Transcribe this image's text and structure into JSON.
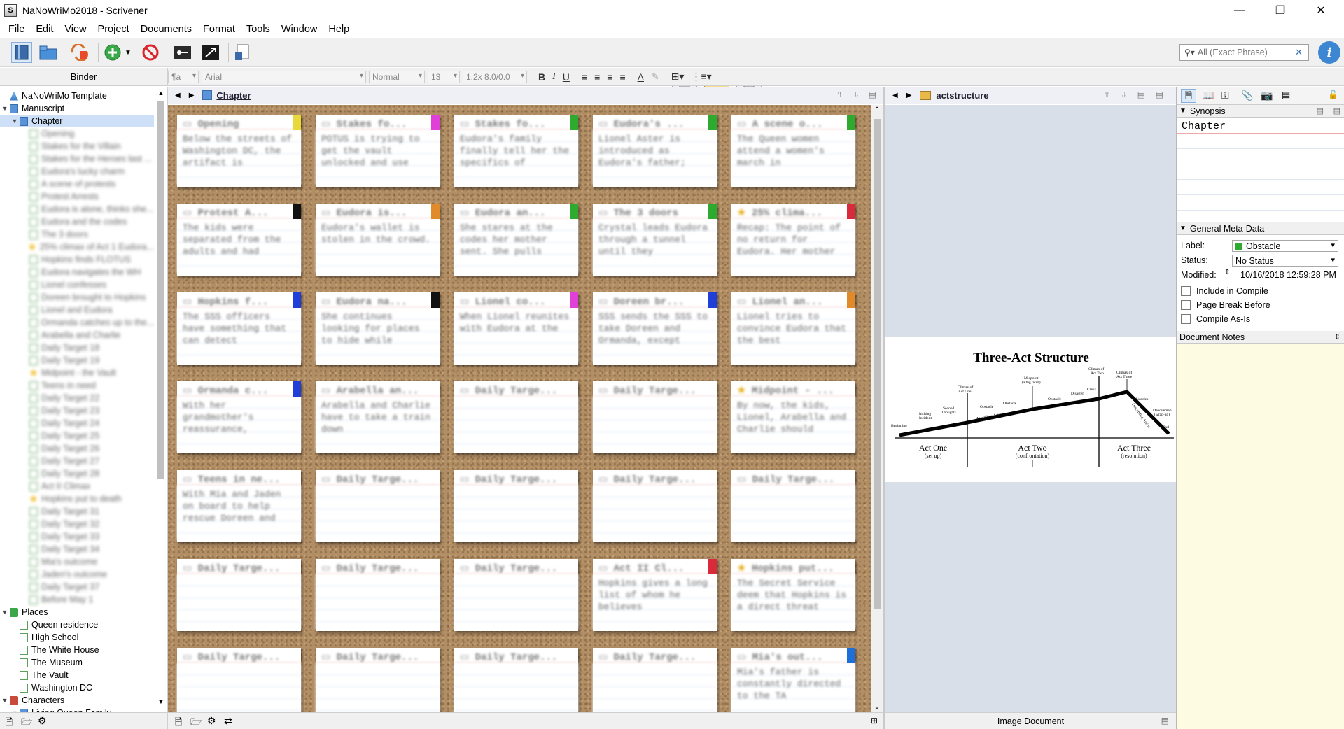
{
  "window": {
    "title": "NaNoWriMo2018 - Scrivener"
  },
  "menu": [
    "File",
    "Edit",
    "View",
    "Project",
    "Documents",
    "Format",
    "Tools",
    "Window",
    "Help"
  ],
  "search": {
    "placeholder": "All (Exact Phrase)"
  },
  "format_bar": {
    "style": "¶a",
    "font": "Arial",
    "weight": "Normal",
    "size": "13",
    "spacing": "1.2x 8.0/0.0"
  },
  "binder": {
    "header": "Binder",
    "items": [
      {
        "label": "NaNoWriMo Template",
        "level": 0,
        "type": "template",
        "blur": false
      },
      {
        "label": "Manuscript",
        "level": 0,
        "type": "manuscript",
        "blur": false
      },
      {
        "label": "Chapter",
        "level": 1,
        "type": "folder",
        "blur": false,
        "selected": true
      },
      {
        "label": "Opening",
        "level": 2,
        "type": "doc",
        "blur": true
      },
      {
        "label": "Stakes for the Villain",
        "level": 2,
        "type": "doc",
        "blur": true
      },
      {
        "label": "Stakes for the Heroes last ...",
        "level": 2,
        "type": "doc",
        "blur": true
      },
      {
        "label": "Eudora's lucky charm",
        "level": 2,
        "type": "doc",
        "blur": true
      },
      {
        "label": "A scene of protests",
        "level": 2,
        "type": "doc",
        "blur": true
      },
      {
        "label": "Protest Arrests",
        "level": 2,
        "type": "doc",
        "blur": true
      },
      {
        "label": "Eudora is alone, thinks she...",
        "level": 2,
        "type": "doc",
        "blur": true
      },
      {
        "label": "Eudora and the codes",
        "level": 2,
        "type": "doc",
        "blur": true
      },
      {
        "label": "The 3 doors",
        "level": 2,
        "type": "doc",
        "blur": true
      },
      {
        "label": "25% climax of Act 1 Eudora...",
        "level": 2,
        "type": "star",
        "blur": true
      },
      {
        "label": "Hopkins finds FLOTUS",
        "level": 2,
        "type": "doc",
        "blur": true
      },
      {
        "label": "Eudora navigates the WH",
        "level": 2,
        "type": "doc",
        "blur": true
      },
      {
        "label": "Lionel confesses",
        "level": 2,
        "type": "doc",
        "blur": true
      },
      {
        "label": "Doreen brought to Hopkins",
        "level": 2,
        "type": "doc",
        "blur": true
      },
      {
        "label": "Lionel and Eudora",
        "level": 2,
        "type": "doc",
        "blur": true
      },
      {
        "label": "Ormanda catches up to the...",
        "level": 2,
        "type": "doc",
        "blur": true
      },
      {
        "label": "Arabella and Charlie",
        "level": 2,
        "type": "doc",
        "blur": true
      },
      {
        "label": "Daily Target 18",
        "level": 2,
        "type": "doc",
        "blur": true
      },
      {
        "label": "Daily Target 19",
        "level": 2,
        "type": "doc",
        "blur": true
      },
      {
        "label": "Midpoint - the Vault",
        "level": 2,
        "type": "star",
        "blur": true
      },
      {
        "label": "Teens in need",
        "level": 2,
        "type": "doc",
        "blur": true
      },
      {
        "label": "Daily Target 22",
        "level": 2,
        "type": "doc",
        "blur": true
      },
      {
        "label": "Daily Target 23",
        "level": 2,
        "type": "doc",
        "blur": true
      },
      {
        "label": "Daily Target 24",
        "level": 2,
        "type": "doc",
        "blur": true
      },
      {
        "label": "Daily Target 25",
        "level": 2,
        "type": "doc",
        "blur": true
      },
      {
        "label": "Daily Target 26",
        "level": 2,
        "type": "doc",
        "blur": true
      },
      {
        "label": "Daily Target 27",
        "level": 2,
        "type": "doc",
        "blur": true
      },
      {
        "label": "Daily Target 28",
        "level": 2,
        "type": "doc",
        "blur": true
      },
      {
        "label": "Act II Climax",
        "level": 2,
        "type": "doc",
        "blur": true
      },
      {
        "label": "Hopkins put to death",
        "level": 2,
        "type": "star",
        "blur": true
      },
      {
        "label": "Daily Target 31",
        "level": 2,
        "type": "doc",
        "blur": true
      },
      {
        "label": "Daily Target 32",
        "level": 2,
        "type": "doc",
        "blur": true
      },
      {
        "label": "Daily Target 33",
        "level": 2,
        "type": "doc",
        "blur": true
      },
      {
        "label": "Daily Target 34",
        "level": 2,
        "type": "doc",
        "blur": true
      },
      {
        "label": "Mia's outcome",
        "level": 2,
        "type": "doc",
        "blur": true
      },
      {
        "label": "Jaden's outcome",
        "level": 2,
        "type": "doc",
        "blur": true
      },
      {
        "label": "Daily Target 37",
        "level": 2,
        "type": "doc",
        "blur": true
      },
      {
        "label": "Before May 1",
        "level": 2,
        "type": "doc",
        "blur": true
      },
      {
        "label": "Places",
        "level": 0,
        "type": "places",
        "blur": false
      },
      {
        "label": "Queen residence",
        "level": 1,
        "type": "doc",
        "blur": false
      },
      {
        "label": "High School",
        "level": 1,
        "type": "doc",
        "blur": false
      },
      {
        "label": "The White House",
        "level": 1,
        "type": "doc",
        "blur": false
      },
      {
        "label": "The Museum",
        "level": 1,
        "type": "doc",
        "blur": false
      },
      {
        "label": "The Vault",
        "level": 1,
        "type": "doc",
        "blur": false
      },
      {
        "label": "Washington DC",
        "level": 1,
        "type": "doc",
        "blur": false
      },
      {
        "label": "Characters",
        "level": 0,
        "type": "chars",
        "blur": false
      },
      {
        "label": "Living Queen Family",
        "level": 1,
        "type": "folder",
        "blur": false
      }
    ]
  },
  "editor": {
    "title": "Chapter"
  },
  "cards": [
    {
      "title": "Opening",
      "body": "Below the streets of Washington DC, the artifact is",
      "label": "#e8d83a",
      "star": false
    },
    {
      "title": "Stakes fo...",
      "body": "POTUS is trying to get the vault unlocked and use",
      "label": "#e040d8",
      "star": false
    },
    {
      "title": "Stakes fo...",
      "body": "Eudora's family finally tell her the specifics of",
      "label": "#2eaa2e",
      "star": false
    },
    {
      "title": "Eudora's ...",
      "body": "Lionel Aster is introduced as Eudora's father;",
      "label": "#2eaa2e",
      "star": false
    },
    {
      "title": "A scene o...",
      "body": "The Queen women attend a women's march in",
      "label": "#2eaa2e",
      "star": false
    },
    {
      "title": "Protest A...",
      "body": "The kids were separated from the adults and had",
      "label": "#111111",
      "star": false
    },
    {
      "title": "Eudora is...",
      "body": "Eudora's wallet is stolen in the crowd.",
      "label": "#e08a2a",
      "star": false
    },
    {
      "title": "Eudora an...",
      "body": "She stares at the codes her mother sent. She pulls",
      "label": "#2eaa2e",
      "star": false
    },
    {
      "title": "The 3 doors",
      "body": "Crystal leads Eudora through a tunnel until they",
      "label": "#2eaa2e",
      "star": false
    },
    {
      "title": "25% clima...",
      "body": "Recap: The point of no return for Eudora. Her mother",
      "label": "#d82a3a",
      "star": true
    },
    {
      "title": "Hopkins f...",
      "body": "The SSS officers have something that can detect",
      "label": "#1f3fd8",
      "star": false
    },
    {
      "title": "Eudora na...",
      "body": "She continues looking for places to hide while",
      "label": "#111111",
      "star": false
    },
    {
      "title": "Lionel co...",
      "body": "When Lionel reunites with Eudora at the",
      "label": "#e040d8",
      "star": false
    },
    {
      "title": "Doreen br...",
      "body": "SSS sends the SSS to take Doreen and Ormanda, except",
      "label": "#1f3fd8",
      "star": false
    },
    {
      "title": "Lionel an...",
      "body": "Lionel tries to convince Eudora that the best",
      "label": "#e08a2a",
      "star": false
    },
    {
      "title": "Ormanda c...",
      "body": "With her grandmother's reassurance,",
      "label": "#1f3fd8",
      "star": false
    },
    {
      "title": "Arabella an...",
      "body": "Arabella and Charlie have to take a train down",
      "label": "",
      "star": false
    },
    {
      "title": "Daily Targe...",
      "body": "",
      "label": "",
      "star": false
    },
    {
      "title": "Daily Targe...",
      "body": "",
      "label": "",
      "star": false
    },
    {
      "title": "Midpoint - ...",
      "body": "By now, the kids, Lionel, Arabella and Charlie should",
      "label": "",
      "star": true
    },
    {
      "title": "Teens in ne...",
      "body": "With Mia and Jaden on board to help rescue Doreen and",
      "label": "",
      "star": false
    },
    {
      "title": "Daily Targe...",
      "body": "",
      "label": "",
      "star": false
    },
    {
      "title": "Daily Targe...",
      "body": "",
      "label": "",
      "star": false
    },
    {
      "title": "Daily Targe...",
      "body": "",
      "label": "",
      "star": false
    },
    {
      "title": "Daily Targe...",
      "body": "",
      "label": "",
      "star": false
    },
    {
      "title": "Daily Targe...",
      "body": "",
      "label": "",
      "star": false
    },
    {
      "title": "Daily Targe...",
      "body": "",
      "label": "",
      "star": false
    },
    {
      "title": "Daily Targe...",
      "body": "",
      "label": "",
      "star": false
    },
    {
      "title": "Act II Cl...",
      "body": "Hopkins gives a long list of whom he believes",
      "label": "#d82a3a",
      "star": false
    },
    {
      "title": "Hopkins put...",
      "body": "The Secret Service deem that Hopkins is a direct threat",
      "label": "",
      "star": true
    },
    {
      "title": "Daily Targe...",
      "body": "",
      "label": "",
      "star": false
    },
    {
      "title": "Daily Targe...",
      "body": "",
      "label": "",
      "star": false
    },
    {
      "title": "Daily Targe...",
      "body": "",
      "label": "",
      "star": false
    },
    {
      "title": "Daily Targe...",
      "body": "",
      "label": "",
      "star": false
    },
    {
      "title": "Mia's out...",
      "body": "Mia's father is constantly directed to the TA",
      "label": "#1f6fd8",
      "star": false
    }
  ],
  "editor2": {
    "title": "actstructure",
    "footer": "Image Document",
    "image": {
      "title": "Three-Act Structure",
      "labels": {
        "beginning": "Beginning",
        "inciting": "Inciting",
        "incident": "Incident",
        "second": "Second",
        "thoughts": "Thoughts",
        "climax1a": "Climax of",
        "climax1b": "Act One",
        "obstacle": "Obstacle",
        "midpoint": "Midpoint",
        "twist": "(a big twist)",
        "disaster": "Disaster",
        "crisis": "Crisis",
        "climax2a": "Climax of",
        "climax2b": "Act Two",
        "climax3a": "Climax of",
        "climax3b": "Act Three",
        "obstacles": "Obstacles",
        "denouement": "Denouement",
        "wrapup": "(wrap-up)",
        "end": "End",
        "ascending": "Ascending Action",
        "descending": "Descending Action",
        "act1": "Act One",
        "act1sub": "(set up)",
        "act2": "Act Two",
        "act2sub": "(confrontation)",
        "act3": "Act Three",
        "act3sub": "(resolution)"
      }
    }
  },
  "inspector": {
    "synopsis_header": "Synopsis",
    "synopsis_text": "Chapter",
    "meta_header": "General Meta-Data",
    "label_caption": "Label:",
    "label_value": "Obstacle",
    "label_color": "#2eaa2e",
    "status_caption": "Status:",
    "status_value": "No Status",
    "modified_caption": "Modified:",
    "modified_value": "10/16/2018 12:59:28 PM",
    "include_compile": "Include in Compile",
    "page_break": "Page Break Before",
    "compile_as_is": "Compile As-Is",
    "notes_header": "Document Notes"
  }
}
